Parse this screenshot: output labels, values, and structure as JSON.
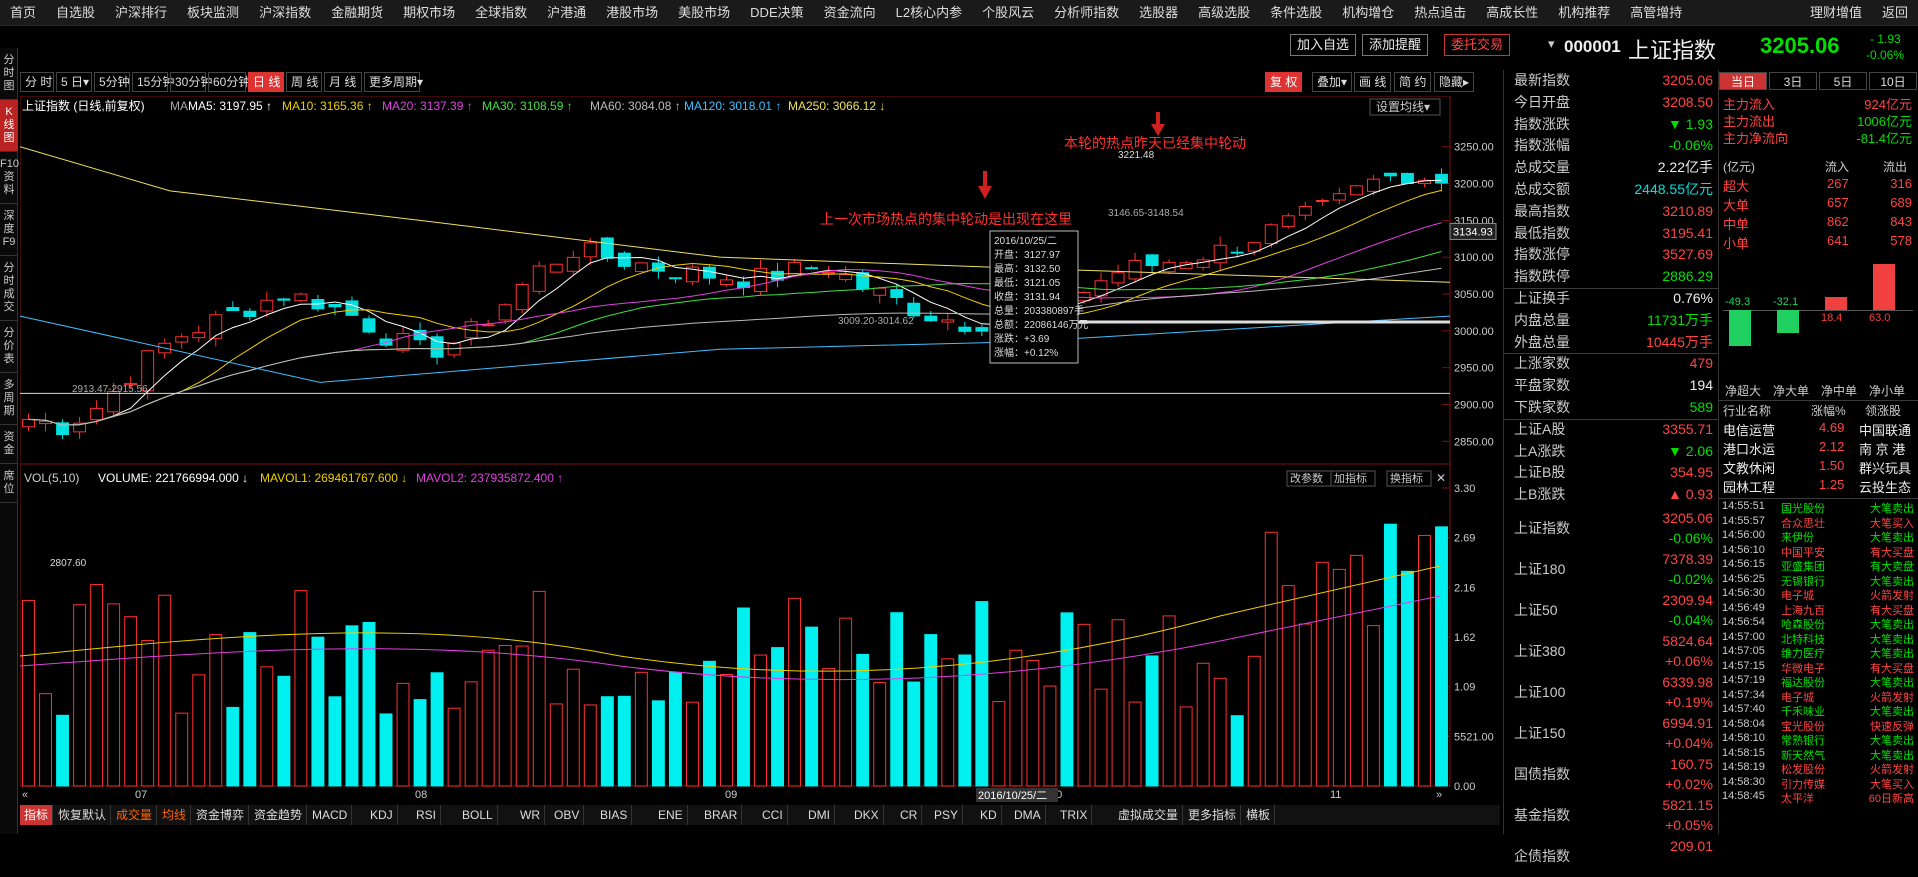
{
  "menu": [
    "首页",
    "自选股",
    "沪深排行",
    "板块监测",
    "沪深指数",
    "金融期货",
    "期权市场",
    "全球指数",
    "沪港通",
    "港股市场",
    "美股市场",
    "DDE决策",
    "资金流向",
    "L2核心内参",
    "个股风云",
    "分析师指数",
    "选股器",
    "高级选股",
    "条件选股",
    "机构增仓",
    "热点追击",
    "高成长性",
    "机构推荐",
    "高管增持",
    "理财增值",
    "返回"
  ],
  "sidebar": [
    "分时图",
    "K线图",
    "F10资料",
    "深度F9",
    "分时成交",
    "分价表",
    "多周期",
    "资金",
    "席位"
  ],
  "actions": {
    "add_watch": "加入自选",
    "add_alert": "添加提醒",
    "trade": "委托交易"
  },
  "index_head": {
    "code": "000001",
    "name": "上证指数",
    "price": "3205.06",
    "chg": "- 1.93",
    "pct": "-0.06%"
  },
  "periods": [
    "分 时",
    "5 日▾",
    "5分钟",
    "15分钟",
    "30分钟",
    "60分钟",
    "日 线",
    "周 线",
    "月 线",
    "更多周期▾"
  ],
  "period_right": [
    "复 权",
    "叠加▾",
    "画 线",
    "简 约",
    "隐藏▸"
  ],
  "ma_line": {
    "title": "上证指数 (日线,前复权)",
    "ma": "MA",
    "ma5": "MA5: 3197.95 ↑",
    "ma10": "MA10: 3165.36 ↑",
    "ma20": "MA20: 3137.39 ↑",
    "ma30": "MA30: 3108.59 ↑",
    "ma60": "MA60: 3084.08 ↑",
    "ma120": "MA120: 3018.01 ↑",
    "ma250": "MA250: 3066.12 ↓",
    "set_ma": "设置均线▾"
  },
  "vol_line": {
    "label": "VOL(5,10)",
    "volume": "VOLUME: 221766994.000 ↓",
    "mavol1": "MAVOL1: 269461767.600 ↓",
    "mavol2": "MAVOL2: 237935872.400 ↑",
    "btn1": "改参数",
    "btn2": "加指标",
    "btn3": "换指标"
  },
  "annotations": {
    "a1": "上一次市场热点的集中轮动是出现在这里",
    "a2": "本轮的热点昨天已经集中轮动",
    "hi_label": "3221.48",
    "lo_label": "2807.60",
    "mid_label1": "3009.20-3014.62",
    "mid_label2": "3146.65-3148.54",
    "left_label": "2913.47-2915.56",
    "cur_price": "3134.93"
  },
  "tooltip": [
    "2016/10/25/二",
    "开盘：3127.97",
    "最高：3132.50",
    "最低：3121.05",
    "收盘：3131.94",
    "总量：203380897手",
    "总额：22086146万元",
    "涨跌：+3.69",
    "涨幅：+0.12%"
  ],
  "price_axis": [
    "3250.00",
    "3200.00",
    "3150.00",
    "3100.00",
    "3050.00",
    "3000.00",
    "2950.00",
    "2900.00",
    "2850.00"
  ],
  "vol_axis": [
    "3.30",
    "2.69",
    "2.16",
    "1.62",
    "1.09",
    "5521.00",
    "0.00"
  ],
  "months": [
    "07",
    "08",
    "09",
    "10",
    "11"
  ],
  "date_cursor": "2016/10/25/二",
  "tabs": [
    "指标",
    "恢复默认",
    "成交量",
    "均线",
    "资金博弈",
    "资金趋势",
    "MACD",
    "KDJ",
    "RSI",
    "BOLL",
    "WR",
    "OBV",
    "BIAS",
    "ENE",
    "BRAR",
    "CCI",
    "DMI",
    "DKX",
    "CR",
    "PSY",
    "KD",
    "DMA",
    "TRIX",
    "虚拟成交量",
    "更多指标",
    "横板"
  ],
  "mid_rows": [
    [
      "最新指数",
      "3205.06",
      "red"
    ],
    [
      "今日开盘",
      "3208.50",
      "red"
    ],
    [
      "指数涨跌",
      "▼ 1.93",
      "grn"
    ],
    [
      "指数涨幅",
      "-0.06%",
      "grn"
    ],
    [
      "总成交量",
      "2.22亿手",
      "wht"
    ],
    [
      "总成交额",
      "2448.55亿元",
      "cyn"
    ],
    [
      "最高指数",
      "3210.89",
      "red"
    ],
    [
      "最低指数",
      "3195.41",
      "red"
    ],
    [
      "指数涨停",
      "3527.69",
      "red"
    ],
    [
      "指数跌停",
      "2886.29",
      "grn"
    ],
    [
      "上证换手",
      "0.76%",
      "wht"
    ],
    [
      "内盘总量",
      "11731万手",
      "grn"
    ],
    [
      "外盘总量",
      "10445万手",
      "red"
    ],
    [
      "上涨家数",
      "479",
      "red"
    ],
    [
      "平盘家数",
      "194",
      "wht"
    ],
    [
      "下跌家数",
      "589",
      "grn"
    ],
    [
      "上证A股",
      "3355.71",
      "red"
    ],
    [
      "上A涨跌",
      "▼ 2.06",
      "grn"
    ],
    [
      "上证B股",
      "354.95",
      "red"
    ],
    [
      "上B涨跌",
      "▲ 0.93",
      "red"
    ]
  ],
  "mid_lower": [
    [
      "上证指数",
      "3205.06",
      "-0.06%"
    ],
    [
      "上证180",
      "7378.39",
      "-0.02%"
    ],
    [
      "上证50",
      "2309.94",
      "-0.04%"
    ],
    [
      "上证380",
      "5824.64",
      "+0.06%"
    ],
    [
      "上证100",
      "6339.98",
      "+0.19%"
    ],
    [
      "上证150",
      "6994.91",
      "+0.04%"
    ],
    [
      "国债指数",
      "160.75",
      "+0.02%"
    ],
    [
      "基金指数",
      "5821.15",
      "+0.05%"
    ],
    [
      "企债指数",
      "209.01",
      ""
    ]
  ],
  "right_tabs": [
    "当日",
    "3日",
    "5日",
    "10日"
  ],
  "flow": [
    [
      "主力流入",
      "924亿元",
      "red"
    ],
    [
      "主力流出",
      "1006亿元",
      "grn"
    ],
    [
      "主力净流向",
      "-81.4亿元",
      "grn"
    ]
  ],
  "flow_table_head": [
    "(亿元)",
    "流入",
    "流出"
  ],
  "flow_table": [
    [
      "超大",
      "267",
      "316"
    ],
    [
      "大单",
      "657",
      "689"
    ],
    [
      "中单",
      "862",
      "843"
    ],
    [
      "小单",
      "641",
      "578"
    ]
  ],
  "netbars": {
    "values": [
      -49.3,
      -32.1,
      18.4,
      63.0
    ],
    "labels": [
      "净超大",
      "净大单",
      "净中单",
      "净小单"
    ],
    "value_labels": [
      "-49.3",
      "-32.1",
      "18.4",
      "63.0"
    ]
  },
  "industry_head": [
    "行业名称",
    "涨幅%",
    "领涨股"
  ],
  "industry": [
    [
      "电信运营",
      "4.69",
      "中国联通"
    ],
    [
      "港口水运",
      "2.12",
      "南 京 港"
    ],
    [
      "文教休闲",
      "1.50",
      "群兴玩具"
    ],
    [
      "园林工程",
      "1.25",
      "云投生态"
    ]
  ],
  "trades": [
    [
      "14:55:51",
      "国光股份",
      "大笔卖出",
      "grn"
    ],
    [
      "14:55:57",
      "合众思壮",
      "大笔买入",
      "red"
    ],
    [
      "14:56:00",
      "来伊份",
      "大笔卖出",
      "grn"
    ],
    [
      "14:56:10",
      "中国平安",
      "有大买盘",
      "red"
    ],
    [
      "14:56:15",
      "亚盛集团",
      "有大卖盘",
      "grn"
    ],
    [
      "14:56:25",
      "无锡银行",
      "大笔卖出",
      "grn"
    ],
    [
      "14:56:30",
      "电子城",
      "火箭发射",
      "red"
    ],
    [
      "14:56:49",
      "上海九百",
      "有大买盘",
      "red"
    ],
    [
      "14:56:54",
      "哈森股份",
      "大笔卖出",
      "grn"
    ],
    [
      "14:57:00",
      "北特科技",
      "大笔卖出",
      "grn"
    ],
    [
      "14:57:05",
      "维力医疗",
      "大笔卖出",
      "grn"
    ],
    [
      "14:57:15",
      "华微电子",
      "有大买盘",
      "red"
    ],
    [
      "14:57:19",
      "福达股份",
      "大笔卖出",
      "grn"
    ],
    [
      "14:57:34",
      "电子城",
      "火箭发射",
      "red"
    ],
    [
      "14:57:40",
      "千禾味业",
      "大笔卖出",
      "grn"
    ],
    [
      "14:58:04",
      "宝光股份",
      "快速反弹",
      "red"
    ],
    [
      "14:58:10",
      "常熟银行",
      "大笔卖出",
      "grn"
    ],
    [
      "14:58:15",
      "新天然气",
      "大笔卖出",
      "grn"
    ],
    [
      "14:58:19",
      "松发股份",
      "火箭发射",
      "red"
    ],
    [
      "14:58:30",
      "引力传媒",
      "大笔买入",
      "red"
    ],
    [
      "14:58:45",
      "太平洋",
      "60日新高",
      "red"
    ]
  ]
}
